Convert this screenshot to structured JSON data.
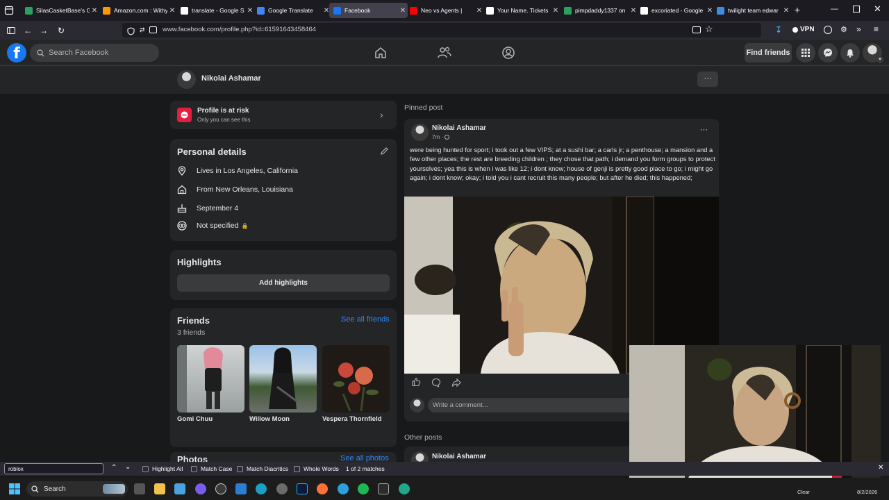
{
  "browser": {
    "tabs": [
      {
        "label": "SilasCasketBase's Ga",
        "color": "#2ba160"
      },
      {
        "label": "Amazon.com : Withy",
        "color": "#ff9900"
      },
      {
        "label": "translate - Google S",
        "color": "#ffffff"
      },
      {
        "label": "Google Translate",
        "color": "#4285f4"
      },
      {
        "label": "Facebook",
        "color": "#1877f2"
      },
      {
        "label": "Neo vs Agents |",
        "color": "#ff0000"
      },
      {
        "label": "Your Name. Tickets",
        "color": "#ffffff"
      },
      {
        "label": "pimpdaddy1337 on",
        "color": "#2ba160"
      },
      {
        "label": "excoriated - Google",
        "color": "#ffffff"
      },
      {
        "label": "twilight team edwar",
        "color": "#3d8ee0"
      }
    ],
    "url": "www.facebook.com/profile.php?id=61591643458464",
    "vpn_label": "VPN"
  },
  "fbnav": {
    "logo": "f",
    "search_placeholder": "Search Facebook",
    "find_friends": "Find friends"
  },
  "profile": {
    "name": "Nikolai Ashamar",
    "more": "···"
  },
  "risk": {
    "title": "Profile is at risk",
    "subtitle": "Only you can see this"
  },
  "personal_details": {
    "heading": "Personal details",
    "rows": [
      {
        "text": "Lives in Los Angeles, California",
        "icon": "location-pin-icon"
      },
      {
        "text": "From New Orleans, Louisiana",
        "icon": "home-icon"
      },
      {
        "text": "September 4",
        "icon": "birthday-cake-icon"
      },
      {
        "text": "Not specified",
        "icon": "relationship-icon"
      }
    ]
  },
  "highlights": {
    "heading": "Highlights",
    "button": "Add highlights"
  },
  "friends": {
    "heading": "Friends",
    "count": "3 friends",
    "see_all": "See all friends",
    "list": [
      {
        "name": "Gomi Chuu"
      },
      {
        "name": "Willow Moon"
      },
      {
        "name": "Vespera Thornfield"
      }
    ]
  },
  "photos": {
    "heading": "Photos",
    "see_all": "See all photos"
  },
  "pinned": {
    "label": "Pinned post",
    "author": "Nikolai Ashamar",
    "time": "7m · ",
    "text": "were being hunted for sport; i took out a few VIPS; at a sushi bar; a carls jr; a penthouse; a mansion and a few other places; the rest are breeding children ; they chose that path; i demand you form groups to protect yourselves; yea this is when i was like 12; i dont know; house of genji is pretty good place to go; i might go again; i dont know; okay; i told you i cant recruit this many people; but after he died; this happened;",
    "comment_placeholder": "Write a comment..."
  },
  "other_posts": {
    "label": "Other posts",
    "author": "Nikolai Ashamar"
  },
  "findbar": {
    "query": "roblox",
    "highlight_all": "Highlight All",
    "match_case": "Match Case",
    "match_diacritics": "Match Diacritics",
    "whole_words": "Whole Words",
    "result": "1 of 2 matches"
  },
  "taskbar": {
    "search": "Search",
    "weather": "Clear",
    "date": "8/2/2026"
  }
}
